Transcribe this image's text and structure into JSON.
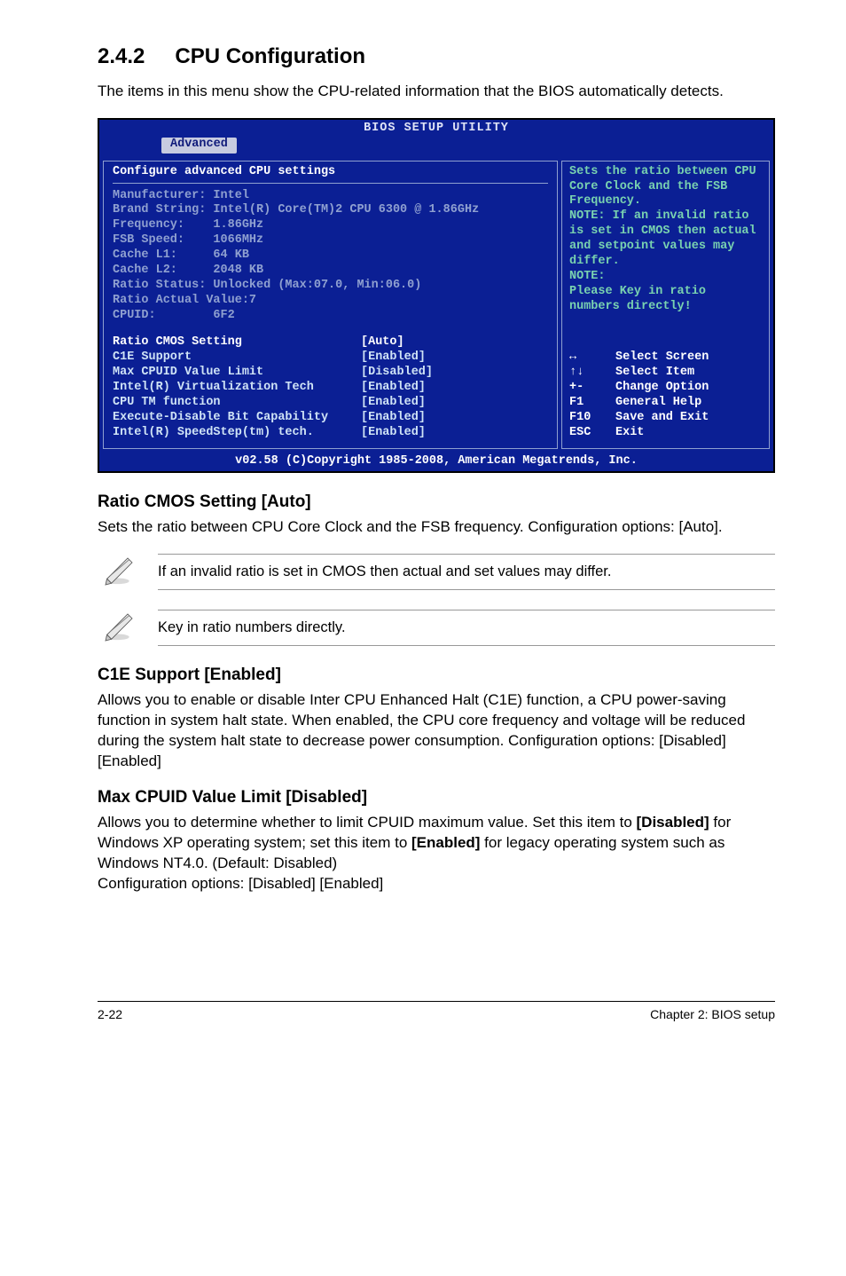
{
  "section": {
    "number": "2.4.2",
    "title": "CPU Configuration"
  },
  "intro": "The items in this menu show the CPU-related information that the BIOS automatically detects.",
  "bios": {
    "title": "BIOS SETUP UTILITY",
    "tab": "Advanced",
    "left_title": "Configure advanced CPU settings",
    "info_lines": [
      "Manufacturer: Intel",
      "Brand String: Intel(R) Core(TM)2 CPU 6300 @ 1.86GHz",
      "Frequency:    1.86GHz",
      "FSB Speed:    1066MHz",
      "Cache L1:     64 KB",
      "Cache L2:     2048 KB",
      "Ratio Status: Unlocked (Max:07.0, Min:06.0)",
      "Ratio Actual Value:7",
      "CPUID:        6F2"
    ],
    "settings": [
      {
        "label": "Ratio CMOS Setting",
        "value": "[Auto]",
        "hl": true
      },
      {
        "label": "C1E Support",
        "value": "[Enabled]",
        "hl": false
      },
      {
        "label": "Max CPUID Value Limit",
        "value": "[Disabled]",
        "hl": false
      },
      {
        "label": "Intel(R) Virtualization Tech",
        "value": "[Enabled]",
        "hl": false
      },
      {
        "label": "CPU TM function",
        "value": "[Enabled]",
        "hl": false
      },
      {
        "label": "Execute-Disable Bit Capability",
        "value": "[Enabled]",
        "hl": false
      },
      {
        "label": "Intel(R) SpeedStep(tm) tech.",
        "value": "[Enabled]",
        "hl": false
      }
    ],
    "help": "Sets the ratio between CPU Core Clock and the FSB Frequency.\nNOTE: If an invalid ratio is set in CMOS then actual and setpoint values may differ.\nNOTE:\nPlease Key in ratio numbers directly!",
    "keys": [
      {
        "k": "↔",
        "d": "Select Screen"
      },
      {
        "k": "↑↓",
        "d": "Select Item"
      },
      {
        "k": "+-",
        "d": "Change Option"
      },
      {
        "k": "F1",
        "d": "General Help"
      },
      {
        "k": "F10",
        "d": "Save and Exit"
      },
      {
        "k": "ESC",
        "d": "Exit"
      }
    ],
    "footer": "v02.58 (C)Copyright 1985-2008, American Megatrends, Inc."
  },
  "ratio": {
    "title": "Ratio CMOS Setting [Auto]",
    "text": "Sets the ratio between CPU Core Clock and the FSB frequency. Configuration options: [Auto]."
  },
  "note1": "If an invalid ratio is set in CMOS then actual and set values may differ.",
  "note2": "Key in ratio numbers directly.",
  "c1e": {
    "title": "C1E Support [Enabled]",
    "text": "Allows you to enable or disable Inter CPU Enhanced Halt (C1E) function, a CPU power-saving function in system halt state. When enabled, the CPU core frequency and voltage will be reduced during the system halt state to decrease power consumption. Configuration options: [Disabled] [Enabled]"
  },
  "cpuid": {
    "title": "Max CPUID Value Limit [Disabled]",
    "p1a": "Allows you to determine whether to limit CPUID maximum value. Set this item to ",
    "p1b": "[Disabled]",
    "p1c": " for Windows XP operating system; set this item to ",
    "p1d": "[Enabled]",
    "p1e": " for legacy operating system such as Windows NT4.0. (Default: Disabled)",
    "p2": "Configuration options: [Disabled] [Enabled]"
  },
  "footer": {
    "left": "2-22",
    "right": "Chapter 2: BIOS setup"
  }
}
